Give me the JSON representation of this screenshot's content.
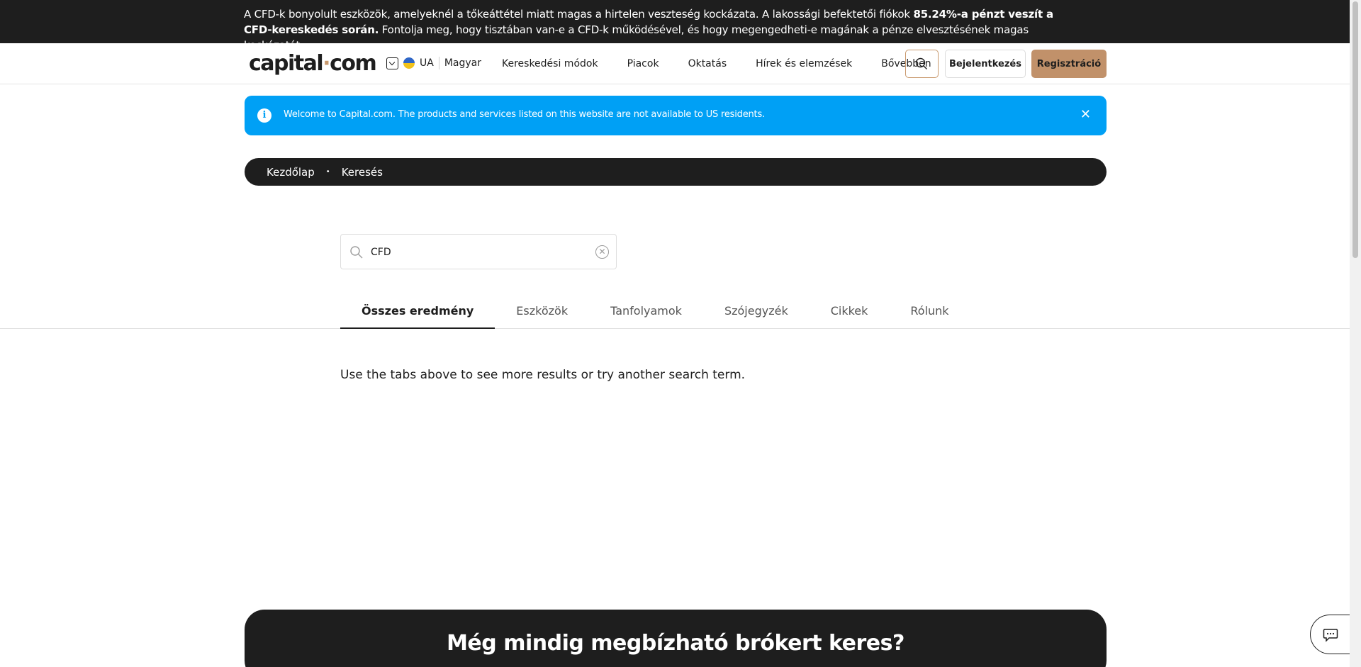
{
  "risk_banner": {
    "text_start": "A CFD-k bonyolult eszközök, amelyeknél a tőkeáttétel miatt magas a hirtelen veszteség kockázata. A lakossági befektetői fiókok ",
    "text_bold": "85.24%-a pénzt veszít a CFD-kereskedés során.",
    "text_end": " Fontolja meg, hogy tisztában van-e a CFD-k működésével, és hogy megengedheti-e magának a pénze elvesztésének magas kockázatát"
  },
  "header": {
    "logo_left": "capital",
    "logo_dot": "·",
    "logo_right": "com",
    "region": "UA",
    "language": "Magyar",
    "nav": [
      "Kereskedési módok",
      "Piacok",
      "Oktatás",
      "Hírek és elemzések",
      "Bővebben"
    ],
    "login_label": "Bejelentkezés",
    "register_label": "Regisztráció"
  },
  "info_banner": {
    "text": "Welcome to Capital.com. The products and services listed on this website are not available to US residents.",
    "close": "✕"
  },
  "breadcrumb": {
    "home": "Kezdőlap",
    "separator": "•",
    "current": "Keresés"
  },
  "search": {
    "value": "CFD",
    "clear": "✕"
  },
  "tabs": [
    "Összes eredmény",
    "Eszközök",
    "Tanfolyamok",
    "Szójegyzék",
    "Cikkek",
    "Rólunk"
  ],
  "active_tab": "Összes eredmény",
  "empty_message": "Use the tabs above to see more results or try another search term.",
  "cta": {
    "title": "Még mindig megbízható brókert keres?"
  },
  "colors": {
    "dark": "#1e1e1e",
    "accent": "#c1916a",
    "info_blue": "#00a0f5"
  },
  "icons": {
    "search": "search-icon",
    "clear": "clear-icon",
    "info": "info-icon",
    "close": "close-icon",
    "chat": "chat-icon",
    "dropdown": "chevron-down-icon",
    "flag": "ukraine-flag-icon"
  }
}
